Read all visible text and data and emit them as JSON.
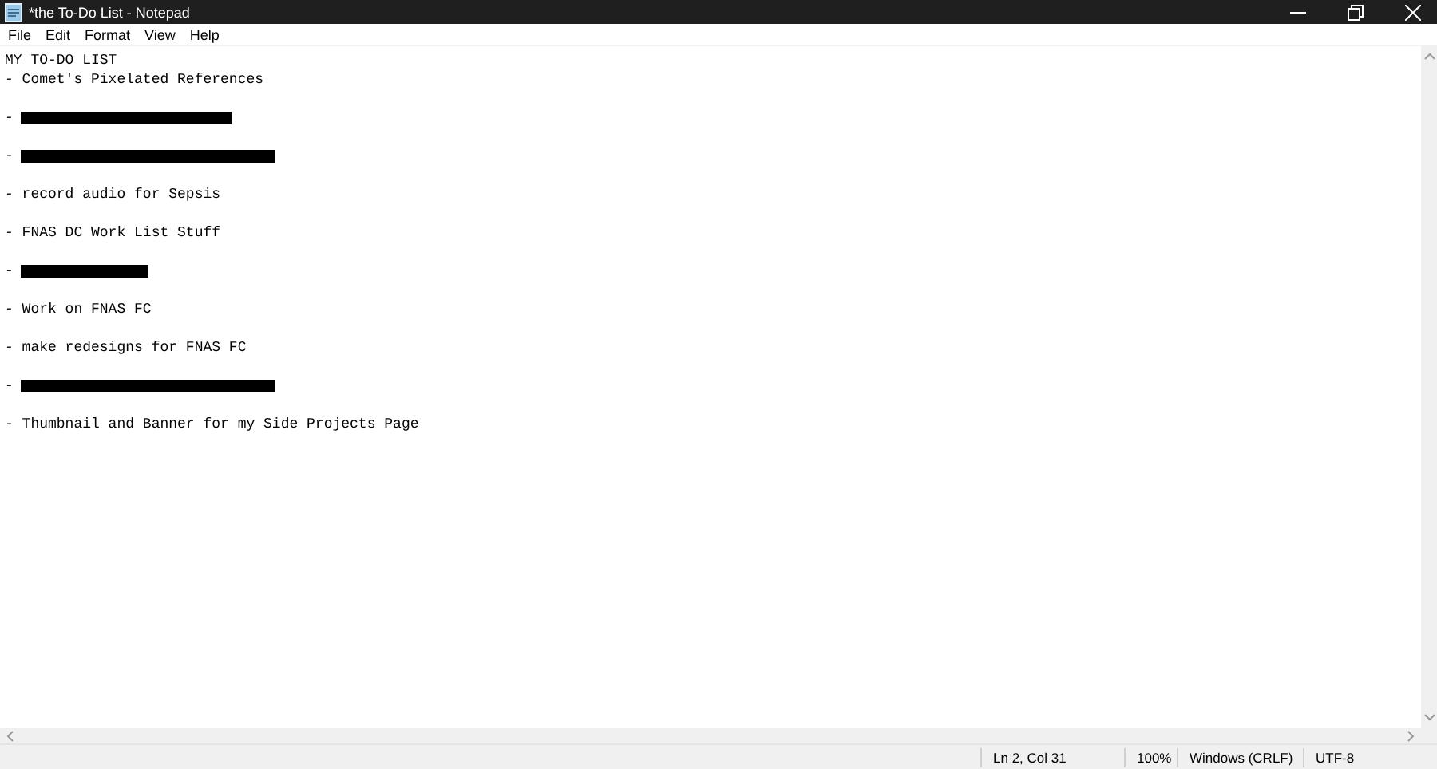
{
  "window": {
    "title": "*the To-Do List - Notepad"
  },
  "menu": [
    "File",
    "Edit",
    "Format",
    "View",
    "Help"
  ],
  "document": {
    "lines": [
      {
        "kind": "text",
        "text": "MY TO-DO LIST"
      },
      {
        "kind": "text",
        "text": "- Comet's Pixelated References"
      },
      {
        "kind": "blank"
      },
      {
        "kind": "redacted_medium",
        "text": "-"
      },
      {
        "kind": "blank"
      },
      {
        "kind": "redacted_long",
        "text": "-"
      },
      {
        "kind": "blank"
      },
      {
        "kind": "text",
        "text": "- record audio for Sepsis"
      },
      {
        "kind": "blank"
      },
      {
        "kind": "text",
        "text": "- FNAS DC Work List Stuff"
      },
      {
        "kind": "blank"
      },
      {
        "kind": "redacted_short",
        "text": "-"
      },
      {
        "kind": "blank"
      },
      {
        "kind": "text",
        "text": "- Work on FNAS FC"
      },
      {
        "kind": "blank"
      },
      {
        "kind": "text",
        "text": "- make redesigns for FNAS FC"
      },
      {
        "kind": "blank"
      },
      {
        "kind": "redacted_long",
        "text": "-"
      },
      {
        "kind": "blank"
      },
      {
        "kind": "text",
        "text": "- Thumbnail and Banner for my Side Projects Page"
      }
    ]
  },
  "status_bar": {
    "position": "Ln 2, Col 31",
    "zoom": "100%",
    "line_endings": "Windows (CRLF)",
    "encoding": "UTF-8"
  }
}
